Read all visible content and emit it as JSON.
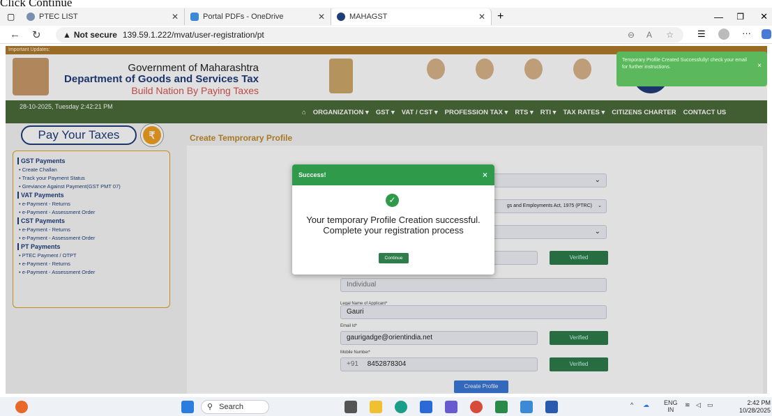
{
  "caption": "Click Continue",
  "browser": {
    "tabs": [
      {
        "label": "PTEC LIST"
      },
      {
        "label": "Portal PDFs - OneDrive"
      },
      {
        "label": "MAHAGST"
      }
    ],
    "new_tab": "+",
    "not_secure": "Not secure",
    "url": "139.59.1.222/mvat/user-registration/pt"
  },
  "site": {
    "updates_label": "Important Updates:",
    "gov_line1": "Government of Maharashtra",
    "gov_line2": "Department of Goods and Services Tax",
    "gov_line3": "Build Nation By Paying Taxes",
    "datetime": "28-10-2025, Tuesday 2:42:21 PM",
    "nav": [
      "ORGANIZATION ▾",
      "GST ▾",
      "VAT / CST ▾",
      "PROFESSION TAX ▾",
      "RTS ▾",
      "RTI ▾",
      "TAX RATES ▾",
      "CITIZENS CHARTER",
      "CONTACT US"
    ]
  },
  "sidebar": {
    "pay_taxes": "Pay Your Taxes",
    "sections": [
      {
        "title": "GST Payments",
        "items": [
          "• Create Challan",
          "• Track your Payment Status",
          "• Greviance Against Payment(GST PMT 07)"
        ]
      },
      {
        "title": "VAT Payments",
        "items": [
          "• e-Payment - Returns",
          "• e-Payment - Assessment Order"
        ]
      },
      {
        "title": "CST Payments",
        "items": [
          "• e-Payment - Returns",
          "• e-Payment - Assessment Order"
        ]
      },
      {
        "title": "PT Payments",
        "items": [
          "• PTEC Payment / OTPT",
          "• e-Payment - Returns",
          "• e-Payment - Assessment Order"
        ]
      }
    ]
  },
  "form": {
    "title": "Create Temprorary Profile",
    "act_value": "gs and Employments Act, 1975 (PTRC)",
    "constitution": "Individual",
    "legal_name_label": "Legal Name of Applicant*",
    "legal_name": "Gauri",
    "email_label": "Email Id*",
    "email": "gaurigadge@orientindia.net",
    "mobile_label": "Mobile Number*",
    "mobile_prefix": "+91",
    "mobile": "8452878304",
    "verified": "Verified",
    "create_profile": "Create Profile"
  },
  "modal": {
    "title": "Success!",
    "close": "×",
    "message": "Your temporary Profile Creation successful. Complete your registration process",
    "continue": "Continue"
  },
  "toast": {
    "text": "Temporary Profile Created Successfully! check your email for further instructions.",
    "close": "×"
  },
  "taskbar": {
    "search": "Search",
    "lang1": "ENG",
    "lang2": "IN",
    "time": "2:42 PM",
    "date": "10/28/2025"
  }
}
